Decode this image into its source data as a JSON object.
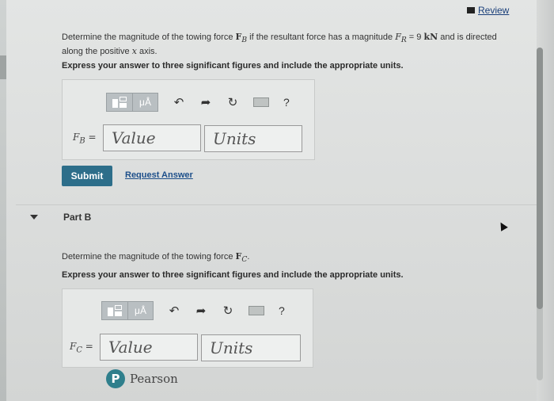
{
  "header": {
    "review_label": "Review"
  },
  "part_a": {
    "question_pre": "Determine the magnitude of the towing force",
    "force_symbol": "F",
    "force_sub": "B",
    "question_mid": " if the resultant force has a magnitude",
    "resultant_symbol": "F",
    "resultant_sub": "R",
    "resultant_value": " = 9 ",
    "resultant_unit": "kN",
    "question_post": " and is directed along the positive",
    "axis_var": "x",
    "question_end": "axis.",
    "instruction": "Express your answer to three significant figures and include the appropriate units.",
    "toolbar": {
      "mu_label": "μÅ",
      "help_label": "?"
    },
    "var_label": "F",
    "var_sub": "B",
    "var_eq": " =",
    "value_placeholder": "Value",
    "units_placeholder": "Units",
    "submit_label": "Submit",
    "request_label": "Request Answer"
  },
  "part_b": {
    "title": "Part B",
    "question_pre": "Determine the magnitude of the towing force",
    "force_symbol": "F",
    "force_sub": "C",
    "question_end": ".",
    "instruction": "Express your answer to three significant figures and include the appropriate units.",
    "toolbar": {
      "mu_label": "μÅ",
      "help_label": "?"
    },
    "var_label": "F",
    "var_sub": "C",
    "var_eq": " =",
    "value_placeholder": "Value",
    "units_placeholder": "Units"
  },
  "footer": {
    "brand_letter": "P",
    "brand": "Pearson"
  },
  "colors": {
    "submit": "#2d6e8a",
    "link": "#1d4f8a",
    "brand": "#2f7f8c"
  }
}
